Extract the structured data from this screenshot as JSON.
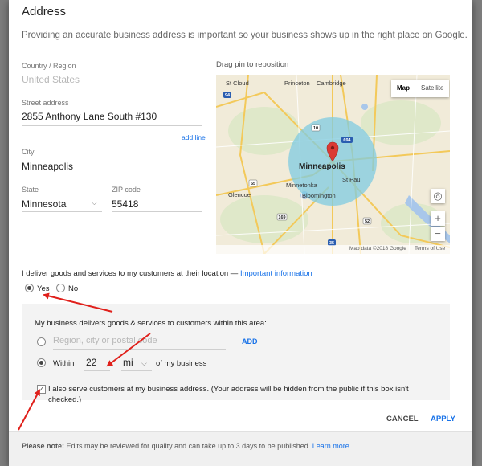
{
  "dialog": {
    "title": "Address",
    "intro": "Providing an accurate business address is important so your business shows up in the right place on Google."
  },
  "form": {
    "country_label": "Country / Region",
    "country_value": "United States",
    "street_label": "Street address",
    "street_value": "2855 Anthony Lane South #130",
    "add_line": "add line",
    "city_label": "City",
    "city_value": "Minneapolis",
    "state_label": "State",
    "state_value": "Minnesota",
    "zip_label": "ZIP code",
    "zip_value": "55418"
  },
  "map": {
    "drag_hint": "Drag pin to reposition",
    "type_map": "Map",
    "type_satellite": "Satellite",
    "zoom_in": "+",
    "zoom_out": "−",
    "attribution": "Map data ©2018 Google",
    "terms": "Terms of Use",
    "places": {
      "st_cloud": "St Cloud",
      "princeton": "Princeton",
      "cambridge": "Cambridge",
      "minneapolis": "Minneapolis",
      "st_paul": "St Paul",
      "minnetonka": "Minnetonka",
      "bloomington": "Bloomington",
      "glencoe": "Glencoe"
    },
    "routes": {
      "r94": "94",
      "r169": "169",
      "r35": "35",
      "r10": "10",
      "r694": "694",
      "r55": "55",
      "r52": "52"
    }
  },
  "service": {
    "question": "I deliver goods and services to my customers at their location —",
    "info_link": "Important information",
    "yes": "Yes",
    "no": "No",
    "area_title": "My business delivers goods & services to customers within this area:",
    "region_placeholder": "Region, city or postal code",
    "add": "ADD",
    "within_label": "Within",
    "within_value": "22",
    "unit_value": "mi",
    "of_business": "of my business",
    "also_serve_line1": "I also serve customers at my business address. (Your address will be hidden from the public if this box isn't",
    "also_serve_line2": "checked.)"
  },
  "actions": {
    "cancel": "CANCEL",
    "apply": "APPLY"
  },
  "footer": {
    "note_bold": "Please note:",
    "note_text": " Edits may be reviewed for quality and can take up to 3 days to be published.",
    "learn_more": "Learn more"
  },
  "colors": {
    "accent": "#1a73e8",
    "arrow": "#e0201b",
    "service_radius": "#7fcbe0",
    "map_pin": "#db3a34"
  }
}
